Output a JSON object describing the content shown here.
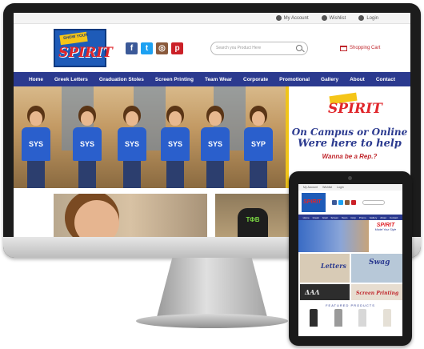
{
  "topbar": {
    "my_account": "My Account",
    "wishlist": "Wishlist",
    "login": "Login"
  },
  "brand": {
    "tagline": "SHOW YOUR",
    "name": "SPIRIT"
  },
  "search": {
    "placeholder": "Search you Product Here"
  },
  "cart": {
    "label": "Shopping Cart"
  },
  "nav": {
    "items": [
      "Home",
      "Greek Letters",
      "Graduation Stoles",
      "Screen Printing",
      "Team Wear",
      "Corporate",
      "Promotional",
      "Gallery",
      "About",
      "Contact"
    ]
  },
  "hero": {
    "shirt_text": [
      "SYS",
      "SYS",
      "SYS",
      "SYS",
      "SYS",
      "SYP"
    ],
    "line1": "On Campus or Online",
    "line2": "Were here to help",
    "line3": "Wanna be a Rep.?"
  },
  "tile2": {
    "shirt_text": "ΤΦΒ"
  },
  "tablet": {
    "topbar": [
      "My Account",
      "Wishlist",
      "Login"
    ],
    "nav": [
      "Home",
      "Greek",
      "Grad",
      "Screen",
      "Team",
      "Corp",
      "Promo",
      "Gallery",
      "About",
      "Contact"
    ],
    "banner_title": "SPIRIT",
    "banner_sub": "Model Your Style",
    "cell_letters": "Letters",
    "cell_swag": "Swag",
    "cell_greek": "ΔΑΛ",
    "cell_screen": "Screen Printing",
    "featured": "FEATURED PRODUCTS"
  },
  "colors": {
    "nav": "#2b3a8f",
    "accent": "#e0262b",
    "brand_blue": "#1e5bb8",
    "gold": "#f0c419"
  }
}
